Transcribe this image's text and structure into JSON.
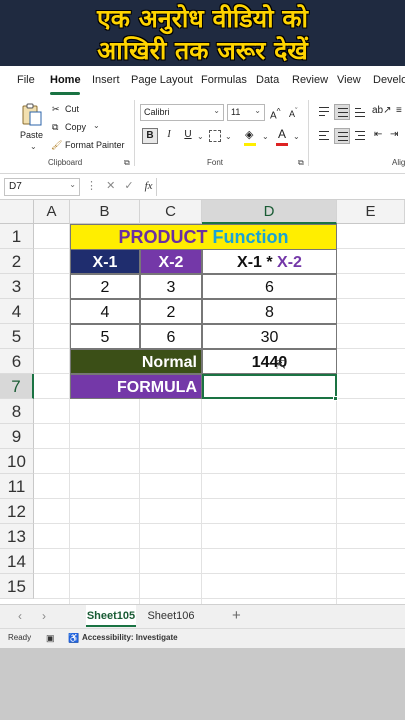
{
  "banner": {
    "line1": "एक अनुरोध वीडियो को",
    "line2": "आखिरी तक जरूर देखें"
  },
  "menu": {
    "items": [
      "File",
      "Home",
      "Insert",
      "Page Layout",
      "Formulas",
      "Data",
      "Review",
      "View",
      "Develo"
    ],
    "active": "Home"
  },
  "ribbon": {
    "paste_label": "Paste",
    "cut_label": "Cut",
    "copy_label": "Copy",
    "format_painter_label": "Format Painter",
    "clipboard_group": "Clipboard",
    "font_name": "Calibri",
    "font_size": "11",
    "bold": "B",
    "italic": "I",
    "underline": "U",
    "font_group": "Font",
    "alignment_group": "Alig"
  },
  "formula_bar": {
    "name_box": "D7",
    "fx_label": "fx",
    "formula": ""
  },
  "columns": [
    "A",
    "B",
    "C",
    "D",
    "E"
  ],
  "rows": [
    "1",
    "2",
    "3",
    "4",
    "5",
    "6",
    "7",
    "8",
    "9",
    "10",
    "11",
    "12",
    "13",
    "14",
    "15"
  ],
  "table": {
    "title_part1": "PRODUCT",
    "title_part2": "Function",
    "headers": {
      "x1": "X-1",
      "x2": "X-2",
      "product_a": "X-1 * ",
      "product_b": "X-2"
    },
    "rows": [
      {
        "x1": "2",
        "x2": "3",
        "product": "6"
      },
      {
        "x1": "4",
        "x2": "2",
        "product": "8"
      },
      {
        "x1": "5",
        "x2": "6",
        "product": "30"
      }
    ],
    "normal_label": "Normal",
    "normal_value": "1440",
    "formula_label": "FORMULA",
    "formula_value": ""
  },
  "sheet_tabs": [
    "Sheet105",
    "Sheet106"
  ],
  "active_sheet": "Sheet105",
  "status": {
    "ready": "Ready",
    "accessibility": "Accessibility: Investigate"
  },
  "colors": {
    "banner_bg": "#1f2a40",
    "banner_text": "#ffd400",
    "title_bg": "#ffee00",
    "navy": "#1f2d6e",
    "purple": "#7438a8",
    "olive": "#3b4f17",
    "excel_green": "#1a7343"
  }
}
